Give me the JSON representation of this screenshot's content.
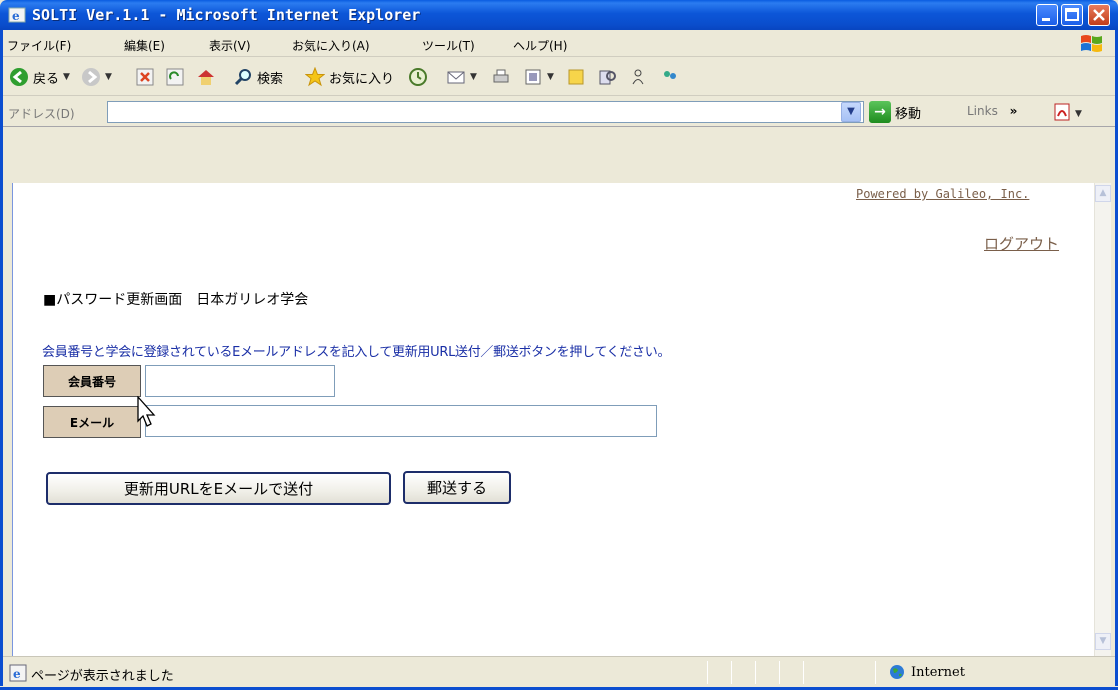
{
  "window": {
    "title": "SOLTI Ver.1.1 - Microsoft Internet Explorer"
  },
  "menu": {
    "items": [
      "ファイル(F)",
      "編集(E)",
      "表示(V)",
      "お気に入り(A)",
      "ツール(T)",
      "ヘルプ(H)"
    ]
  },
  "toolbar": {
    "back_label": "戻る",
    "search_label": "検索",
    "favorites_label": "お気に入り"
  },
  "address_bar": {
    "label": "アドレス(D)",
    "value": "",
    "go_label": "移動",
    "links_label": "Links"
  },
  "page": {
    "powered_by": "Powered by Galileo, Inc.",
    "logout_link": "ログアウト",
    "heading": "■パスワード更新画面　日本ガリレオ学会",
    "instruction": "会員番号と学会に登録されているEメールアドレスを記入して更新用URL送付／郵送ボタンを押してください。",
    "form": {
      "member_number_label": "会員番号",
      "member_number_value": "",
      "email_label": "Eメール",
      "email_value": ""
    },
    "buttons": {
      "send_url_email": "更新用URLをEメールで送付",
      "send_mail": "郵送する"
    }
  },
  "status_bar": {
    "text": "ページが表示されました",
    "zone": "Internet"
  },
  "colors": {
    "titlebar": "#0a4ecd",
    "link_brown": "#7a5f4a",
    "instruction_blue": "#1a2fa6",
    "label_bg": "#ddcdb6"
  }
}
